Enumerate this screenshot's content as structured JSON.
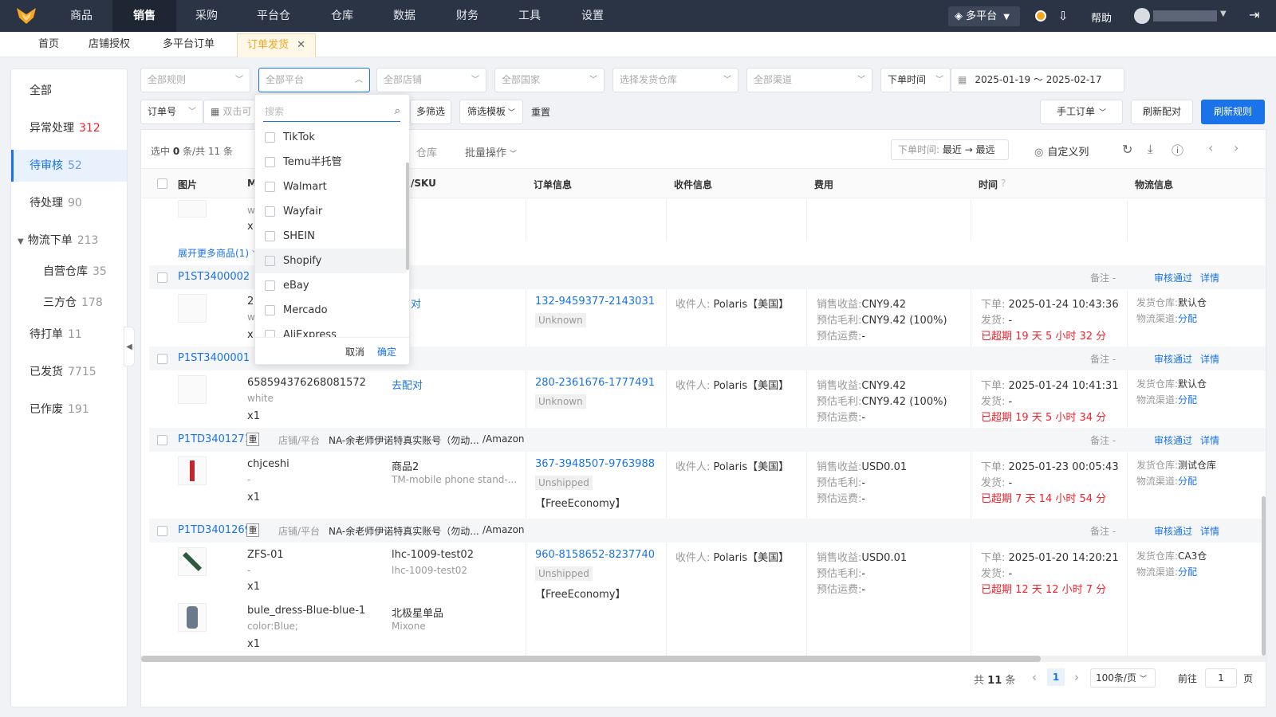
{
  "nav": {
    "items": [
      "商品",
      "销售",
      "采购",
      "平台仓",
      "仓库",
      "数据",
      "财务",
      "工具",
      "设置"
    ],
    "active": "销售",
    "platform_select": "多平台",
    "help": "帮助"
  },
  "tabs": [
    "首页",
    "店铺授权",
    "多平台订单",
    "订单发货"
  ],
  "sidebar": {
    "items": [
      {
        "label": "全部",
        "count": ""
      },
      {
        "label": "异常处理",
        "count": "312"
      },
      {
        "label": "待审核",
        "count": "52"
      },
      {
        "label": "待处理",
        "count": "90"
      },
      {
        "label": "物流下单",
        "count": "213"
      },
      {
        "label": "自营仓库",
        "count": "35"
      },
      {
        "label": "三方仓",
        "count": "178"
      },
      {
        "label": "待打单",
        "count": "11"
      },
      {
        "label": "已发货",
        "count": "7715"
      },
      {
        "label": "已作废",
        "count": "191"
      }
    ]
  },
  "filters": {
    "rule": "全部规则",
    "platform": "全部平台",
    "store": "全部店铺",
    "country": "全部国家",
    "warehouse": "选择发货仓库",
    "channel": "全部渠道",
    "time_type": "下单时间",
    "date_range": "2025-01-19 ～ 2025-02-17",
    "order_no": "订单号",
    "search_placeholder": "双击可",
    "more_filter": "多筛选",
    "filter_template": "筛选模板",
    "reset": "重置",
    "manual_order": "手工订单",
    "refresh_match": "刷新配对",
    "refresh_rules": "刷新规则"
  },
  "dropdown": {
    "search_placeholder": "搜索",
    "options": [
      "TikTok",
      "Temu半托管",
      "Walmart",
      "Wayfair",
      "SHEIN",
      "Shopify",
      "eBay",
      "Mercado",
      "AliExpress"
    ],
    "cancel": "取消",
    "confirm": "确定"
  },
  "toolbar": {
    "selected": "选中",
    "selected_count": "0",
    "total_text": "条/共 11 条",
    "warehouse_tail": "仓库",
    "batch": "批量操作",
    "sort_label": "下单时间:",
    "sort_value": "最近 → 最远",
    "custom_cols": "自定义列"
  },
  "columns": [
    "图片",
    "/SKU",
    "订单信息",
    "收件信息",
    "费用",
    "时间",
    "物流信息"
  ],
  "expand_more": "展开更多商品(1)",
  "orders": [
    {
      "id": "P1ST3400002",
      "store": "",
      "platform": "",
      "note": "备注",
      "note_val": "-",
      "approve": "审核通过",
      "detail": "详情",
      "items": [
        {
          "sku_head": "2",
          "attr": "w",
          "qty": "x1",
          "name": "",
          "sub": "",
          "match": "对"
        }
      ],
      "order_no": "132-9459377-2143031",
      "status": "Unknown",
      "ship": "",
      "recipient": "Polaris【美国】",
      "sale": "CNY9.42",
      "profit": "CNY9.42 (100%)",
      "freight": "-",
      "ordered": "2025-01-24 10:43:36",
      "shipped": "-",
      "overdue": "已超期 19 天 5 小时 32 分",
      "wh": "默认仓",
      "channel": "分配"
    },
    {
      "id": "P1ST3400001",
      "store": "",
      "platform": "",
      "note": "备注",
      "note_val": "-",
      "approve": "审核通过",
      "detail": "详情",
      "items": [
        {
          "sku_head": "658594376268081572",
          "attr": "white",
          "qty": "x1",
          "name": "",
          "sub": "",
          "match": "去配对"
        }
      ],
      "order_no": "280-2361676-1777491",
      "status": "Unknown",
      "ship": "",
      "recipient": "Polaris【美国】",
      "sale": "CNY9.42",
      "profit": "CNY9.42 (100%)",
      "freight": "-",
      "ordered": "2025-01-24 10:41:31",
      "shipped": "-",
      "overdue": "已超期 19 天 5 小时 34 分",
      "wh": "默认仓",
      "channel": "分配"
    },
    {
      "id": "P1TD3401271",
      "tag": "重",
      "store_label": "店铺/平台",
      "store": "NA-余老师伊诺特真实账号（勿动...",
      "platform": "/Amazon",
      "note": "备注",
      "note_val": "-",
      "approve": "审核通过",
      "detail": "详情",
      "items": [
        {
          "sku_head": "chjceshi",
          "attr": "-",
          "qty": "x1",
          "name": "商品2",
          "sub": "TM-mobile phone stand-...",
          "match": ""
        }
      ],
      "order_no": "367-3948507-9763988",
      "status": "Unshipped",
      "ship": "【FreeEconomy】",
      "recipient": "Polaris【美国】",
      "sale": "USD0.01",
      "profit": "-",
      "freight": "-",
      "ordered": "2025-01-23 00:05:43",
      "shipped": "-",
      "overdue": "已超期 7 天 14 小时 54 分",
      "wh": "测试仓库",
      "channel": "分配"
    },
    {
      "id": "P1TD3401269",
      "tag": "重",
      "store_label": "店铺/平台",
      "store": "NA-余老师伊诺特真实账号（勿动...",
      "platform": "/Amazon",
      "note": "备注",
      "note_val": "-",
      "approve": "审核通过",
      "detail": "详情",
      "items": [
        {
          "sku_head": "ZFS-01",
          "attr": "-",
          "qty": "x1",
          "name": "lhc-1009-test02",
          "sub": "lhc-1009-test02",
          "match": ""
        },
        {
          "sku_head": "bule_dress-Blue-blue-1",
          "attr": "color:Blue;",
          "qty": "x1",
          "name": "北极星单品",
          "sub": "Mixone",
          "match": ""
        }
      ],
      "order_no": "960-8158652-8237740",
      "status": "Unshipped",
      "ship": "【FreeEconomy】",
      "recipient": "Polaris【美国】",
      "sale": "USD0.01",
      "profit": "-",
      "freight": "-",
      "ordered": "2025-01-20 14:20:21",
      "shipped": "-",
      "overdue": "已超期 12 天 12 小时 7 分",
      "wh": "CA3仓",
      "channel": "分配"
    }
  ],
  "labels": {
    "recipient": "收件人:",
    "sale": "销售收益:",
    "profit": "预估毛利:",
    "freight": "预估运费:",
    "ordered": "下单:",
    "shipped": "发货:",
    "wh": "发货仓库:",
    "channel": "物流渠道:"
  },
  "top_row": {
    "attr": "w",
    "qty": "x1"
  },
  "pagination": {
    "total_prefix": "共",
    "total": "11",
    "total_suffix": "条",
    "page": "1",
    "per_page": "100条/页",
    "goto": "前往",
    "goto_val": "1",
    "page_unit": "页"
  },
  "colors": {
    "accent": "#1a73e8",
    "nav_bg": "#2b3445",
    "danger": "#f5222d",
    "tab_active": "#f5a623"
  }
}
